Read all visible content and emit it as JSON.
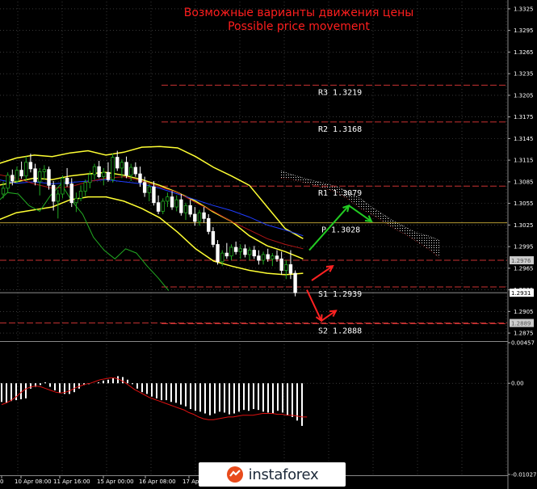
{
  "title_ru": "Возможные варианты движения цены",
  "title_en": "Possible price movement",
  "brand": "instaforex",
  "colors": {
    "background": "#000000",
    "title": "#ff1e1e",
    "level_line": "#c83232",
    "pivot_line": "#b49a33",
    "bollinger": "#ffff33",
    "bull_candle": "#ffffff",
    "bear_candle": "#ffffff",
    "moving_average": "#1e3cff",
    "slow_line": "#b01515",
    "lagging_line": "#22aa22",
    "cloud": "#dddddd",
    "arrow_up": "#22cc22",
    "arrow_down": "#ff2222",
    "grid": "#5a5a5a",
    "axis_text": "#ffffff",
    "histogram": "#ffffff",
    "signal_line": "#dd1111",
    "price_box": "#ffffff",
    "price_box_muted": "#cccccc"
  },
  "chart_data": [
    {
      "type": "candlestick",
      "panel": "main",
      "y_axis_ticks": [
        "1.3325",
        "1.3295",
        "1.3265",
        "1.3235",
        "1.3205",
        "1.3175",
        "1.3145",
        "1.3115",
        "1.3085",
        "1.3055",
        "1.3025",
        "1.2995",
        "1.2965",
        "1.2935",
        "1.2905",
        "1.2875"
      ],
      "ylim": [
        1.2865,
        1.3335
      ],
      "levels": [
        {
          "label": "R3",
          "value": "1.3219"
        },
        {
          "label": "R2",
          "value": "1.3168"
        },
        {
          "label": "R1",
          "value": "1.3079"
        },
        {
          "label": "P",
          "value": "1.3028"
        },
        {
          "label": "S1",
          "value": "1.2939"
        },
        {
          "label": "S2",
          "value": "1.2888"
        }
      ],
      "price_tags": [
        {
          "value": "1.2976",
          "style": "muted"
        },
        {
          "value": "1.2931",
          "style": "current"
        },
        {
          "value": "1.2889",
          "style": "muted"
        }
      ],
      "x_axis_labels": [
        "0",
        "10 Apr 08:00",
        "11 Apr 16:00",
        "15 Apr 00:00",
        "16 Apr 08:00",
        "17 Ap"
      ],
      "candles": [
        [
          1.3068,
          1.3085,
          1.3062,
          1.3076
        ],
        [
          1.3076,
          1.3098,
          1.307,
          1.3094
        ],
        [
          1.3094,
          1.3102,
          1.308,
          1.3086
        ],
        [
          1.3086,
          1.3106,
          1.3083,
          1.3101
        ],
        [
          1.3101,
          1.3113,
          1.3089,
          1.3093
        ],
        [
          1.3093,
          1.312,
          1.3086,
          1.3112
        ],
        [
          1.3112,
          1.3124,
          1.3098,
          1.3103
        ],
        [
          1.3103,
          1.311,
          1.308,
          1.3085
        ],
        [
          1.3085,
          1.3104,
          1.3066,
          1.3099
        ],
        [
          1.3099,
          1.3108,
          1.3088,
          1.3102
        ],
        [
          1.3102,
          1.3106,
          1.3074,
          1.308
        ],
        [
          1.308,
          1.3086,
          1.3045,
          1.3058
        ],
        [
          1.3058,
          1.3074,
          1.3034,
          1.3068
        ],
        [
          1.3068,
          1.3094,
          1.3062,
          1.309
        ],
        [
          1.309,
          1.3104,
          1.3078,
          1.3082
        ],
        [
          1.3082,
          1.309,
          1.305,
          1.3056
        ],
        [
          1.3056,
          1.307,
          1.3043,
          1.3062
        ],
        [
          1.3062,
          1.308,
          1.3058,
          1.3072
        ],
        [
          1.3072,
          1.3088,
          1.3065,
          1.3084
        ],
        [
          1.3084,
          1.31,
          1.3076,
          1.3095
        ],
        [
          1.3095,
          1.311,
          1.3088,
          1.3106
        ],
        [
          1.3106,
          1.3114,
          1.309,
          1.3092
        ],
        [
          1.3092,
          1.3104,
          1.308,
          1.3098
        ],
        [
          1.3098,
          1.3112,
          1.3085,
          1.3088
        ],
        [
          1.3088,
          1.3124,
          1.3084,
          1.3119
        ],
        [
          1.3119,
          1.3128,
          1.31,
          1.3104
        ],
        [
          1.3104,
          1.3116,
          1.309,
          1.3112
        ],
        [
          1.3112,
          1.312,
          1.309,
          1.3094
        ],
        [
          1.3094,
          1.311,
          1.3086,
          1.3105
        ],
        [
          1.3105,
          1.3112,
          1.3092,
          1.3096
        ],
        [
          1.3096,
          1.3106,
          1.3078,
          1.3084
        ],
        [
          1.3084,
          1.3092,
          1.3064,
          1.307
        ],
        [
          1.307,
          1.3082,
          1.3058,
          1.3078
        ],
        [
          1.3078,
          1.3086,
          1.3052,
          1.3056
        ],
        [
          1.3056,
          1.3066,
          1.304,
          1.3044
        ],
        [
          1.3044,
          1.3062,
          1.304,
          1.3058
        ],
        [
          1.3058,
          1.307,
          1.305,
          1.3064
        ],
        [
          1.3064,
          1.3072,
          1.3046,
          1.305
        ],
        [
          1.305,
          1.3066,
          1.3044,
          1.306
        ],
        [
          1.306,
          1.3068,
          1.3038,
          1.3042
        ],
        [
          1.3042,
          1.3056,
          1.3032,
          1.3052
        ],
        [
          1.3052,
          1.306,
          1.3036,
          1.304
        ],
        [
          1.304,
          1.305,
          1.3024,
          1.303
        ],
        [
          1.303,
          1.3046,
          1.3024,
          1.3042
        ],
        [
          1.3042,
          1.305,
          1.3028,
          1.3034
        ],
        [
          1.3034,
          1.304,
          1.3012,
          1.3016
        ],
        [
          1.3016,
          1.3022,
          1.2994,
          1.2998
        ],
        [
          1.2998,
          1.3004,
          1.297,
          1.2974
        ],
        [
          1.2974,
          1.299,
          1.2968,
          1.2986
        ],
        [
          1.2986,
          1.3,
          1.2978,
          1.2982
        ],
        [
          1.2982,
          1.2998,
          1.2976,
          1.2994
        ],
        [
          1.2994,
          1.3002,
          1.2984,
          1.2988
        ],
        [
          1.2988,
          1.2998,
          1.2978,
          1.2992
        ],
        [
          1.2992,
          1.2998,
          1.298,
          1.2984
        ],
        [
          1.2984,
          1.2994,
          1.2976,
          1.299
        ],
        [
          1.299,
          1.2996,
          1.2978,
          1.2982
        ],
        [
          1.2982,
          1.299,
          1.297,
          1.2976
        ],
        [
          1.2976,
          1.2988,
          1.297,
          1.2984
        ],
        [
          1.2984,
          1.2992,
          1.2974,
          1.2978
        ],
        [
          1.2978,
          1.2986,
          1.2968,
          1.2982
        ],
        [
          1.2982,
          1.299,
          1.2974,
          1.2978
        ],
        [
          1.2978,
          1.2988,
          1.2956,
          1.2962
        ],
        [
          1.2962,
          1.2976,
          1.295,
          1.297
        ],
        [
          1.297,
          1.299,
          1.295,
          1.2958
        ],
        [
          1.2958,
          1.2962,
          1.2926,
          1.2931
        ]
      ],
      "bands": {
        "upper": [
          1.311,
          1.3118,
          1.3122,
          1.312,
          1.3125,
          1.3128,
          1.3122,
          1.3126,
          1.3133,
          1.3134,
          1.3132,
          1.312,
          1.3105,
          1.3093,
          1.308,
          1.305,
          1.302,
          1.3006
        ],
        "middle": [
          1.308,
          1.3085,
          1.309,
          1.3088,
          1.3093,
          1.3096,
          1.3098,
          1.3094,
          1.3088,
          1.308,
          1.307,
          1.3058,
          1.3043,
          1.303,
          1.301,
          1.2996,
          1.2988,
          1.2978
        ],
        "lower": [
          1.3032,
          1.3042,
          1.3046,
          1.305,
          1.306,
          1.3064,
          1.3064,
          1.3058,
          1.3048,
          1.3035,
          1.3015,
          1.2992,
          1.2975,
          1.2968,
          1.2962,
          1.2958,
          1.2956,
          1.2958
        ]
      },
      "moving_average": [
        1.3088,
        1.3083,
        1.3085,
        1.3082,
        1.3084,
        1.3086,
        1.3088,
        1.3085,
        1.3082,
        1.3076,
        1.3068,
        1.306,
        1.3052,
        1.3045,
        1.3036,
        1.3025,
        1.3018,
        1.301
      ],
      "slow_line": [
        1.3095,
        1.309,
        1.3082,
        1.3076,
        1.3078,
        1.3085,
        1.309,
        1.3092,
        1.3086,
        1.3078,
        1.307,
        1.3056,
        1.3044,
        1.303,
        1.3018,
        1.3006,
        1.2998,
        1.2992
      ],
      "lagging_line": [
        1.3056,
        1.307,
        1.3068,
        1.3052,
        1.3044,
        1.3066,
        1.3082,
        1.3058,
        1.304,
        1.3008,
        1.299,
        1.2978,
        1.2992,
        1.2986,
        1.2968,
        1.2952,
        1.2934
      ],
      "cloud": {
        "span_a": [
          1.31,
          1.3095,
          1.309,
          1.3086,
          1.3082,
          1.3078,
          1.307,
          1.3062,
          1.305,
          1.304,
          1.303,
          1.3022,
          1.3014,
          1.301,
          1.3004
        ],
        "span_b": [
          1.309,
          1.3088,
          1.3084,
          1.308,
          1.3075,
          1.307,
          1.306,
          1.3048,
          1.304,
          1.303,
          1.302,
          1.3012,
          1.3002,
          1.2992,
          1.298
        ]
      },
      "scenario_arrows": [
        {
          "direction": "up",
          "from": 1.299,
          "via": 1.3052,
          "to": 1.303
        },
        {
          "direction": "down",
          "from": 1.2948,
          "to": 1.2968
        },
        {
          "direction": "down",
          "from": 1.2935,
          "via": 1.2892,
          "to": 1.2906
        }
      ]
    },
    {
      "type": "bar",
      "panel": "oscillator",
      "y_axis_ticks": [
        "0.00457",
        "0.00",
        "-0.01027"
      ],
      "ylim": [
        -0.01027,
        0.00457
      ],
      "values": [
        -0.0021,
        -0.0022,
        -0.002,
        -0.0019,
        -0.0018,
        -0.0017,
        -0.0006,
        -0.0004,
        -0.0002,
        0.0001,
        -0.0004,
        -0.0008,
        -0.0011,
        -0.0012,
        -0.0012,
        -0.001,
        -0.0006,
        -0.0002,
        -0.0001,
        0.0,
        0.0001,
        0.0003,
        0.0004,
        0.0006,
        0.0008,
        0.0007,
        0.0004,
        -0.0001,
        -0.0006,
        -0.001,
        -0.0012,
        -0.0015,
        -0.0017,
        -0.0019,
        -0.0019,
        -0.0021,
        -0.0022,
        -0.0024,
        -0.0026,
        -0.0029,
        -0.0031,
        -0.0032,
        -0.0034,
        -0.0036,
        -0.0034,
        -0.0032,
        -0.0033,
        -0.0035,
        -0.0034,
        -0.0032,
        -0.003,
        -0.0031,
        -0.0029,
        -0.003,
        -0.0032,
        -0.0033,
        -0.0034,
        -0.0031,
        -0.0033,
        -0.0036,
        -0.0038,
        -0.0042,
        -0.0048
      ],
      "signal": [
        -0.0024,
        -0.0022,
        -0.0019,
        -0.0015,
        -0.001,
        -0.0006,
        -0.0004,
        -0.0003,
        -0.0004,
        -0.0006,
        -0.0008,
        -0.001,
        -0.0011,
        -0.001,
        -0.0008,
        -0.0005,
        -0.0003,
        -0.0001,
        0.0,
        0.0002,
        0.0004,
        0.0005,
        0.0006,
        0.0006,
        0.0004,
        0.0001,
        -0.0003,
        -0.0007,
        -0.001,
        -0.0013,
        -0.0016,
        -0.0018,
        -0.002,
        -0.0022,
        -0.0024,
        -0.0026,
        -0.0028,
        -0.003,
        -0.0033,
        -0.0035,
        -0.0038,
        -0.004,
        -0.0041,
        -0.0041,
        -0.004,
        -0.0039,
        -0.0038,
        -0.0038,
        -0.0037,
        -0.0036,
        -0.0036,
        -0.0036,
        -0.0035,
        -0.0034,
        -0.0034,
        -0.0034,
        -0.0035,
        -0.0035,
        -0.0036,
        -0.0036,
        -0.0037,
        -0.0038,
        -0.0038
      ]
    }
  ]
}
